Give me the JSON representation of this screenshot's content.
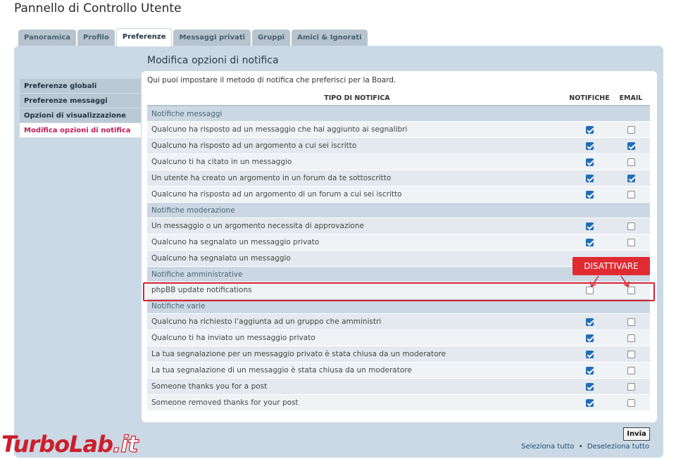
{
  "page_title": "Pannello di Controllo Utente",
  "tabs": [
    {
      "label": "Panoramica",
      "active": false
    },
    {
      "label": "Profilo",
      "active": false
    },
    {
      "label": "Preferenze",
      "active": true
    },
    {
      "label": "Messaggi privati",
      "active": false
    },
    {
      "label": "Gruppi",
      "active": false
    },
    {
      "label": "Amici & Ignorati",
      "active": false
    }
  ],
  "sidenav": [
    {
      "label": "Preferenze globali",
      "active": false
    },
    {
      "label": "Preferenze messaggi",
      "active": false
    },
    {
      "label": "Opzioni di visualizzazione",
      "active": false
    },
    {
      "label": "Modifica opzioni di notifica",
      "active": true
    }
  ],
  "section_title": "Modifica opzioni di notifica",
  "intro": "Qui puoi impostare il metodo di notifica che preferisci per la Board.",
  "table": {
    "col_type": "TIPO DI NOTIFICA",
    "col_notif": "NOTIFICHE",
    "col_email": "EMAIL",
    "groups": [
      {
        "title": "Notifiche messaggi",
        "rows": [
          {
            "label": "Qualcuno ha risposto ad un messaggio che hai aggiunto ai segnalibri",
            "notif": true,
            "email": false
          },
          {
            "label": "Qualcuno ha risposto ad un argomento a cui sei iscritto",
            "notif": true,
            "email": true
          },
          {
            "label": "Qualcuno ti ha citato in un messaggio",
            "notif": true,
            "email": false
          },
          {
            "label": "Un utente ha creato un argomento in un forum da te sottoscritto",
            "notif": true,
            "email": true
          },
          {
            "label": "Qualcuno ha risposto ad un argomento di un forum a cui sei iscritto",
            "notif": true,
            "email": false
          }
        ]
      },
      {
        "title": "Notifiche moderazione",
        "rows": [
          {
            "label": "Un messaggio o un argomento necessita di approvazione",
            "notif": true,
            "email": false
          },
          {
            "label": "Qualcuno ha segnalato un messaggio privato",
            "notif": true,
            "email": false
          },
          {
            "label": "Qualcuno ha segnalato un messaggio",
            "notif": null,
            "email": null
          }
        ]
      },
      {
        "title": "Notifiche amministrative",
        "rows": [
          {
            "label": "phpBB update notifications",
            "notif": false,
            "email": false
          }
        ]
      },
      {
        "title": "Notifiche varie",
        "rows": [
          {
            "label": "Qualcuno ha richiesto l’aggiunta ad un gruppo che amministri",
            "notif": true,
            "email": false
          },
          {
            "label": "Qualcuno ti ha inviato un messaggio privato",
            "notif": true,
            "email": false
          },
          {
            "label": "La tua segnalazione per un messaggio privato è stata chiusa da un moderatore",
            "notif": true,
            "email": false
          },
          {
            "label": "La tua segnalazione di un messaggio è stata chiusa da un moderatore",
            "notif": true,
            "email": false
          },
          {
            "label": "Someone thanks you for a post",
            "notif": true,
            "email": false
          },
          {
            "label": "Someone removed thanks for your post",
            "notif": true,
            "email": false
          }
        ]
      }
    ]
  },
  "callout": "DISATTIVARE",
  "submit_label": "Invia",
  "select_all": "Seleziona tutto",
  "deselect_all": "Deseleziona tutto",
  "bullet": "•",
  "logo": {
    "part1": "Turbo",
    "part2": "Lab",
    "part3": ".it"
  },
  "colors": {
    "accent": "#c21d52",
    "highlight": "#d42431",
    "checkbox": "#1f6cb8",
    "panel": "#cad9e5"
  }
}
